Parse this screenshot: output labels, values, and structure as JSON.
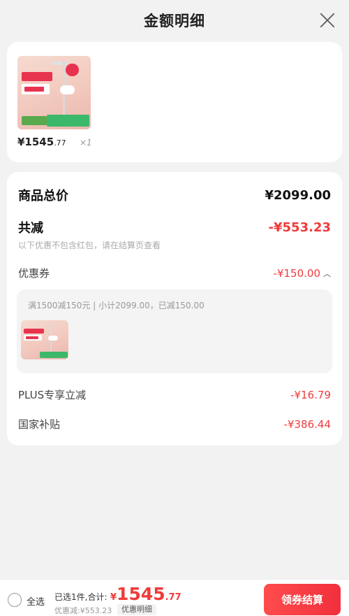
{
  "header": {
    "title": "金额明细",
    "close_icon": "close-icon"
  },
  "product": {
    "price_main": "¥1545",
    "price_decimal": ".77",
    "quantity": "×1"
  },
  "summary": {
    "total_label": "商品总价",
    "total_value": "¥2099.00",
    "discount_label": "共减",
    "discount_value": "-¥553.23",
    "discount_note": "以下优惠不包含红包，请在结算页查看",
    "coupon_label": "优惠券",
    "coupon_value": "-¥150.00",
    "coupon_rule": "满1500减150元 | 小计2099.00，已减150.00",
    "plus_label": "PLUS专享立减",
    "plus_value": "-¥16.79",
    "subsidy_label": "国家补贴",
    "subsidy_value": "-¥386.44"
  },
  "footer": {
    "select_all": "全选",
    "selected_count": "已选1件,合计:",
    "total_currency": "¥",
    "total_int": "1545",
    "total_dec": ".77",
    "discounted": "优惠减:¥553.23",
    "detail_label": "优惠明细",
    "checkout_label": "领券结算"
  },
  "colors": {
    "accent_red": "#ef3b3b",
    "background": "#f2f2f2"
  }
}
